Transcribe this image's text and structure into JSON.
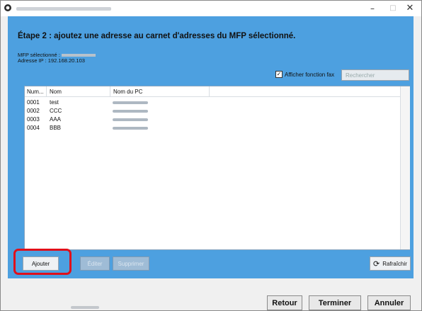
{
  "window": {
    "icon": "app-logo-icon",
    "controls": {
      "minimize": "–",
      "maximize": "□",
      "close": "✕"
    }
  },
  "heading": "Étape 2 : ajoutez une adresse au carnet d'adresses du MFP sélectionné.",
  "info": {
    "mfp_label": "MFP sélectionné :",
    "ip_label": "Adresse IP : 192.168.20.103"
  },
  "fax_option": {
    "label": "Afficher fonction fax",
    "checked": true,
    "check_mark": "✓"
  },
  "search": {
    "placeholder": "Rechercher"
  },
  "list": {
    "columns": [
      "Num...",
      "Nom",
      "Nom du PC"
    ],
    "rows": [
      {
        "num": "0001",
        "nom": "test"
      },
      {
        "num": "0002",
        "nom": "CCC"
      },
      {
        "num": "0003",
        "nom": "AAA"
      },
      {
        "num": "0004",
        "nom": "BBB"
      }
    ]
  },
  "buttons": {
    "add": "Ajouter",
    "edit": "Éditer",
    "delete": "Supprimer",
    "refresh": "Rafraîchir",
    "refresh_icon": "⟳"
  },
  "footer": {
    "back": "Retour",
    "finish": "Terminer",
    "cancel": "Annuler"
  },
  "colors": {
    "accent_panel": "#4da0e0",
    "highlight": "#e0101b",
    "disabled_button": "#9fbcd6"
  }
}
